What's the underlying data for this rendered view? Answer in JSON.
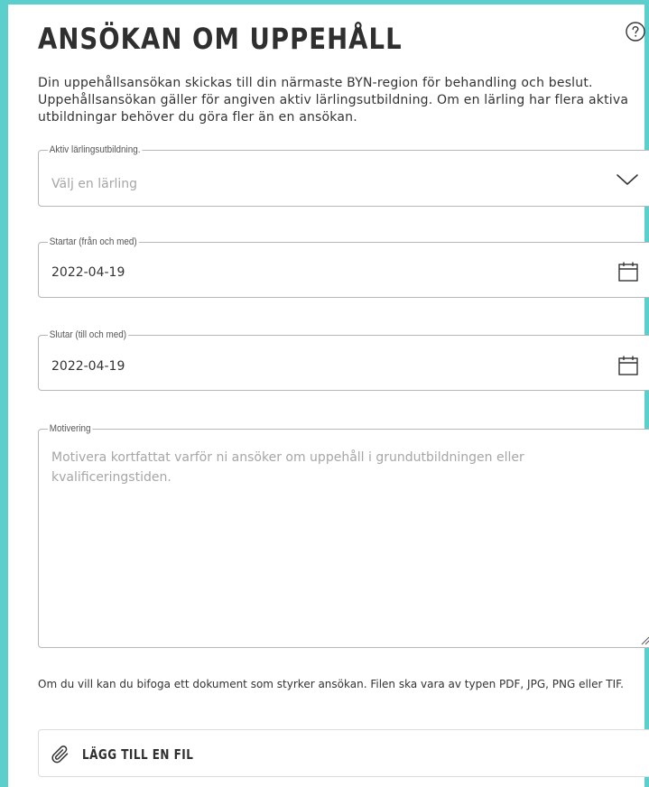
{
  "header": {
    "title": "ANSÖKAN OM UPPEHÅLL",
    "help_icon": "question-circle-icon"
  },
  "intro": {
    "text": "Din uppehållsansökan skickas till din närmaste BYN-region för behandling och beslut. Uppehållsansökan gäller för angiven aktiv lärlingsutbildning. Om en lärling har flera aktiva utbildningar behöver du göra fler än en ansökan."
  },
  "form": {
    "education": {
      "label": "Aktiv lärlingsutbildning.",
      "placeholder": "Välj en lärling",
      "icon": "chevron-down-icon"
    },
    "start_date": {
      "label": "Startar (från och med)",
      "value": "2022-04-19",
      "icon": "calendar-icon"
    },
    "end_date": {
      "label": "Slutar (till och med)",
      "value": "2022-04-19",
      "icon": "calendar-icon"
    },
    "motivation": {
      "label": "Motivering",
      "placeholder": "Motivera kortfattat varför ni ansöker om uppehåll i grundutbildningen eller kvalificeringstiden."
    }
  },
  "attachment": {
    "note": "Om du vill kan du bifoga ett dokument som styrker ansökan. Filen ska vara av typen PDF, JPG, PNG eller TIF.",
    "button_label": "LÄGG TILL EN FIL",
    "icon": "paperclip-icon"
  },
  "colors": {
    "frame_accent": "#5bcfcc",
    "border": "#b7b7b7",
    "placeholder": "#a6a6a6",
    "text": "#333333"
  }
}
